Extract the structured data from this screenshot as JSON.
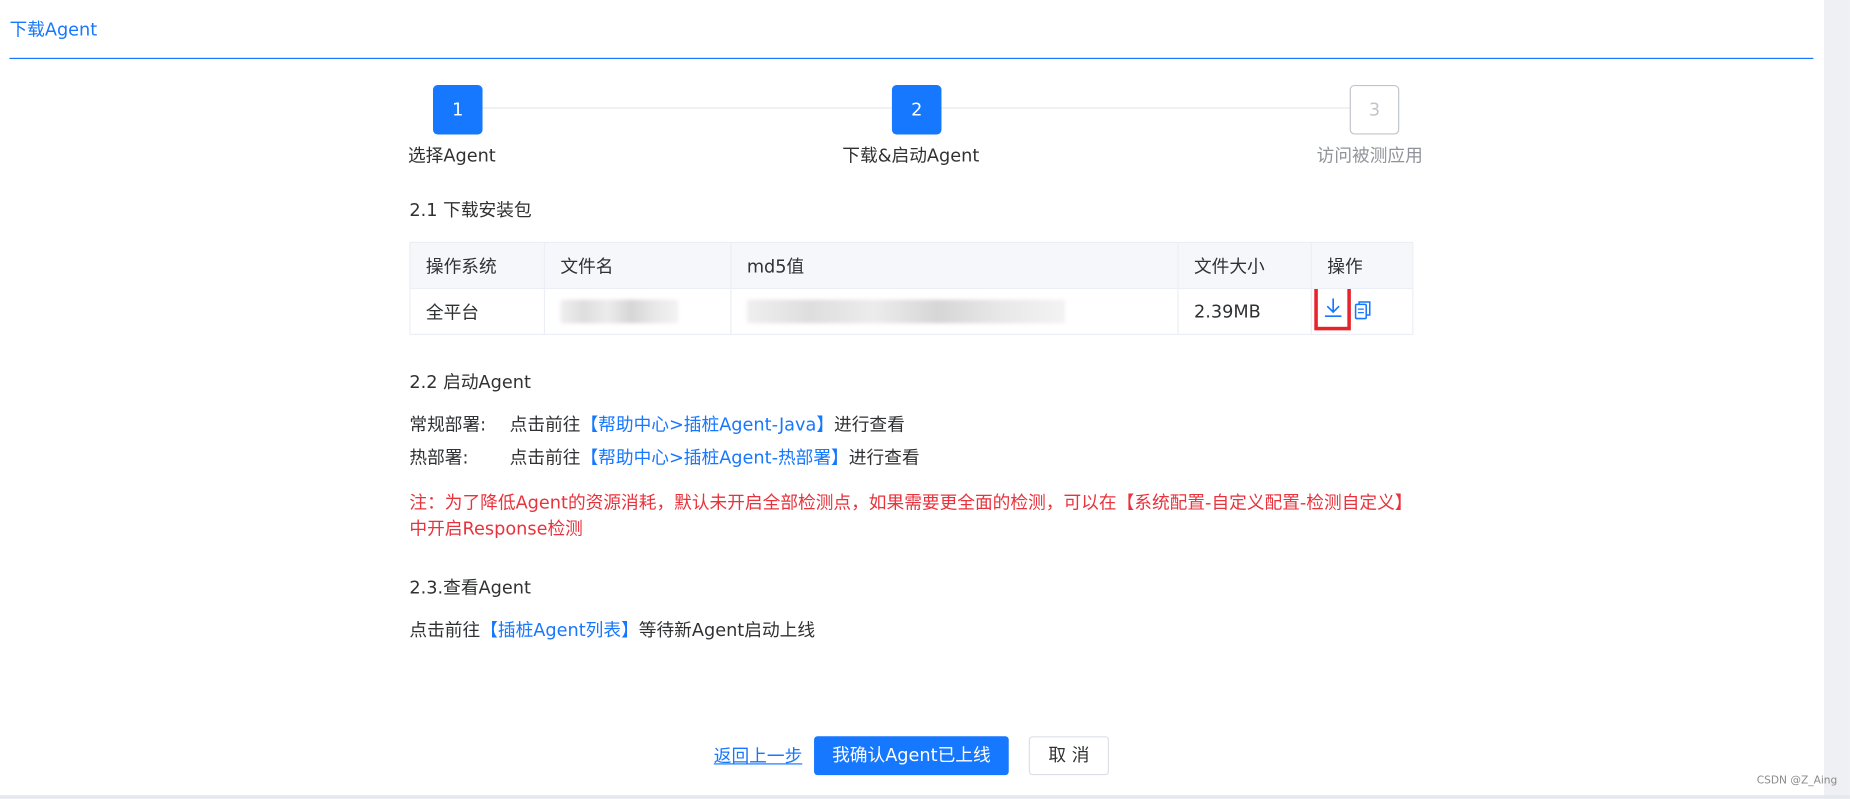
{
  "header": {
    "title": "下载Agent"
  },
  "steps": [
    {
      "number": "1",
      "label": "选择Agent",
      "status": "active"
    },
    {
      "number": "2",
      "label": "下载&启动Agent",
      "status": "active"
    },
    {
      "number": "3",
      "label": "访问被测应用",
      "status": "pending"
    }
  ],
  "download_section": {
    "title": "2.1 下载安装包",
    "columns": [
      "操作系统",
      "文件名",
      "md5值",
      "文件大小",
      "操作"
    ],
    "row": {
      "os": "全平台",
      "file_size": "2.39MB",
      "download_icon": "download-icon",
      "copy_icon": "copy-icon"
    }
  },
  "start_section": {
    "title": "2.2 启动Agent",
    "rows": [
      {
        "label": "常规部署:",
        "prefix": "点击前往",
        "link": "【帮助中心>插桩Agent-Java】",
        "suffix": "进行查看"
      },
      {
        "label": "热部署:",
        "prefix": "点击前往",
        "link": "【帮助中心>插桩Agent-热部署】",
        "suffix": "进行查看"
      }
    ],
    "note_line1": "注：为了降低Agent的资源消耗，默认未开启全部检测点，如果需要更全面的检测，可以在【系统配置-自定义配置-检测自定义】",
    "note_line2": "中开启Response检测"
  },
  "view_section": {
    "title": "2.3.查看Agent",
    "prefix": "点击前往",
    "link": "【插桩Agent列表】",
    "suffix": "等待新Agent启动上线"
  },
  "footer": {
    "back_label": "返回上一步",
    "confirm_label": "我确认Agent已上线",
    "cancel_label": "取 消"
  },
  "watermark": "CSDN @Z_Aing",
  "colors": {
    "primary": "#1677ff",
    "warning_text": "#e8323c",
    "highlight_box": "#e8232b"
  }
}
